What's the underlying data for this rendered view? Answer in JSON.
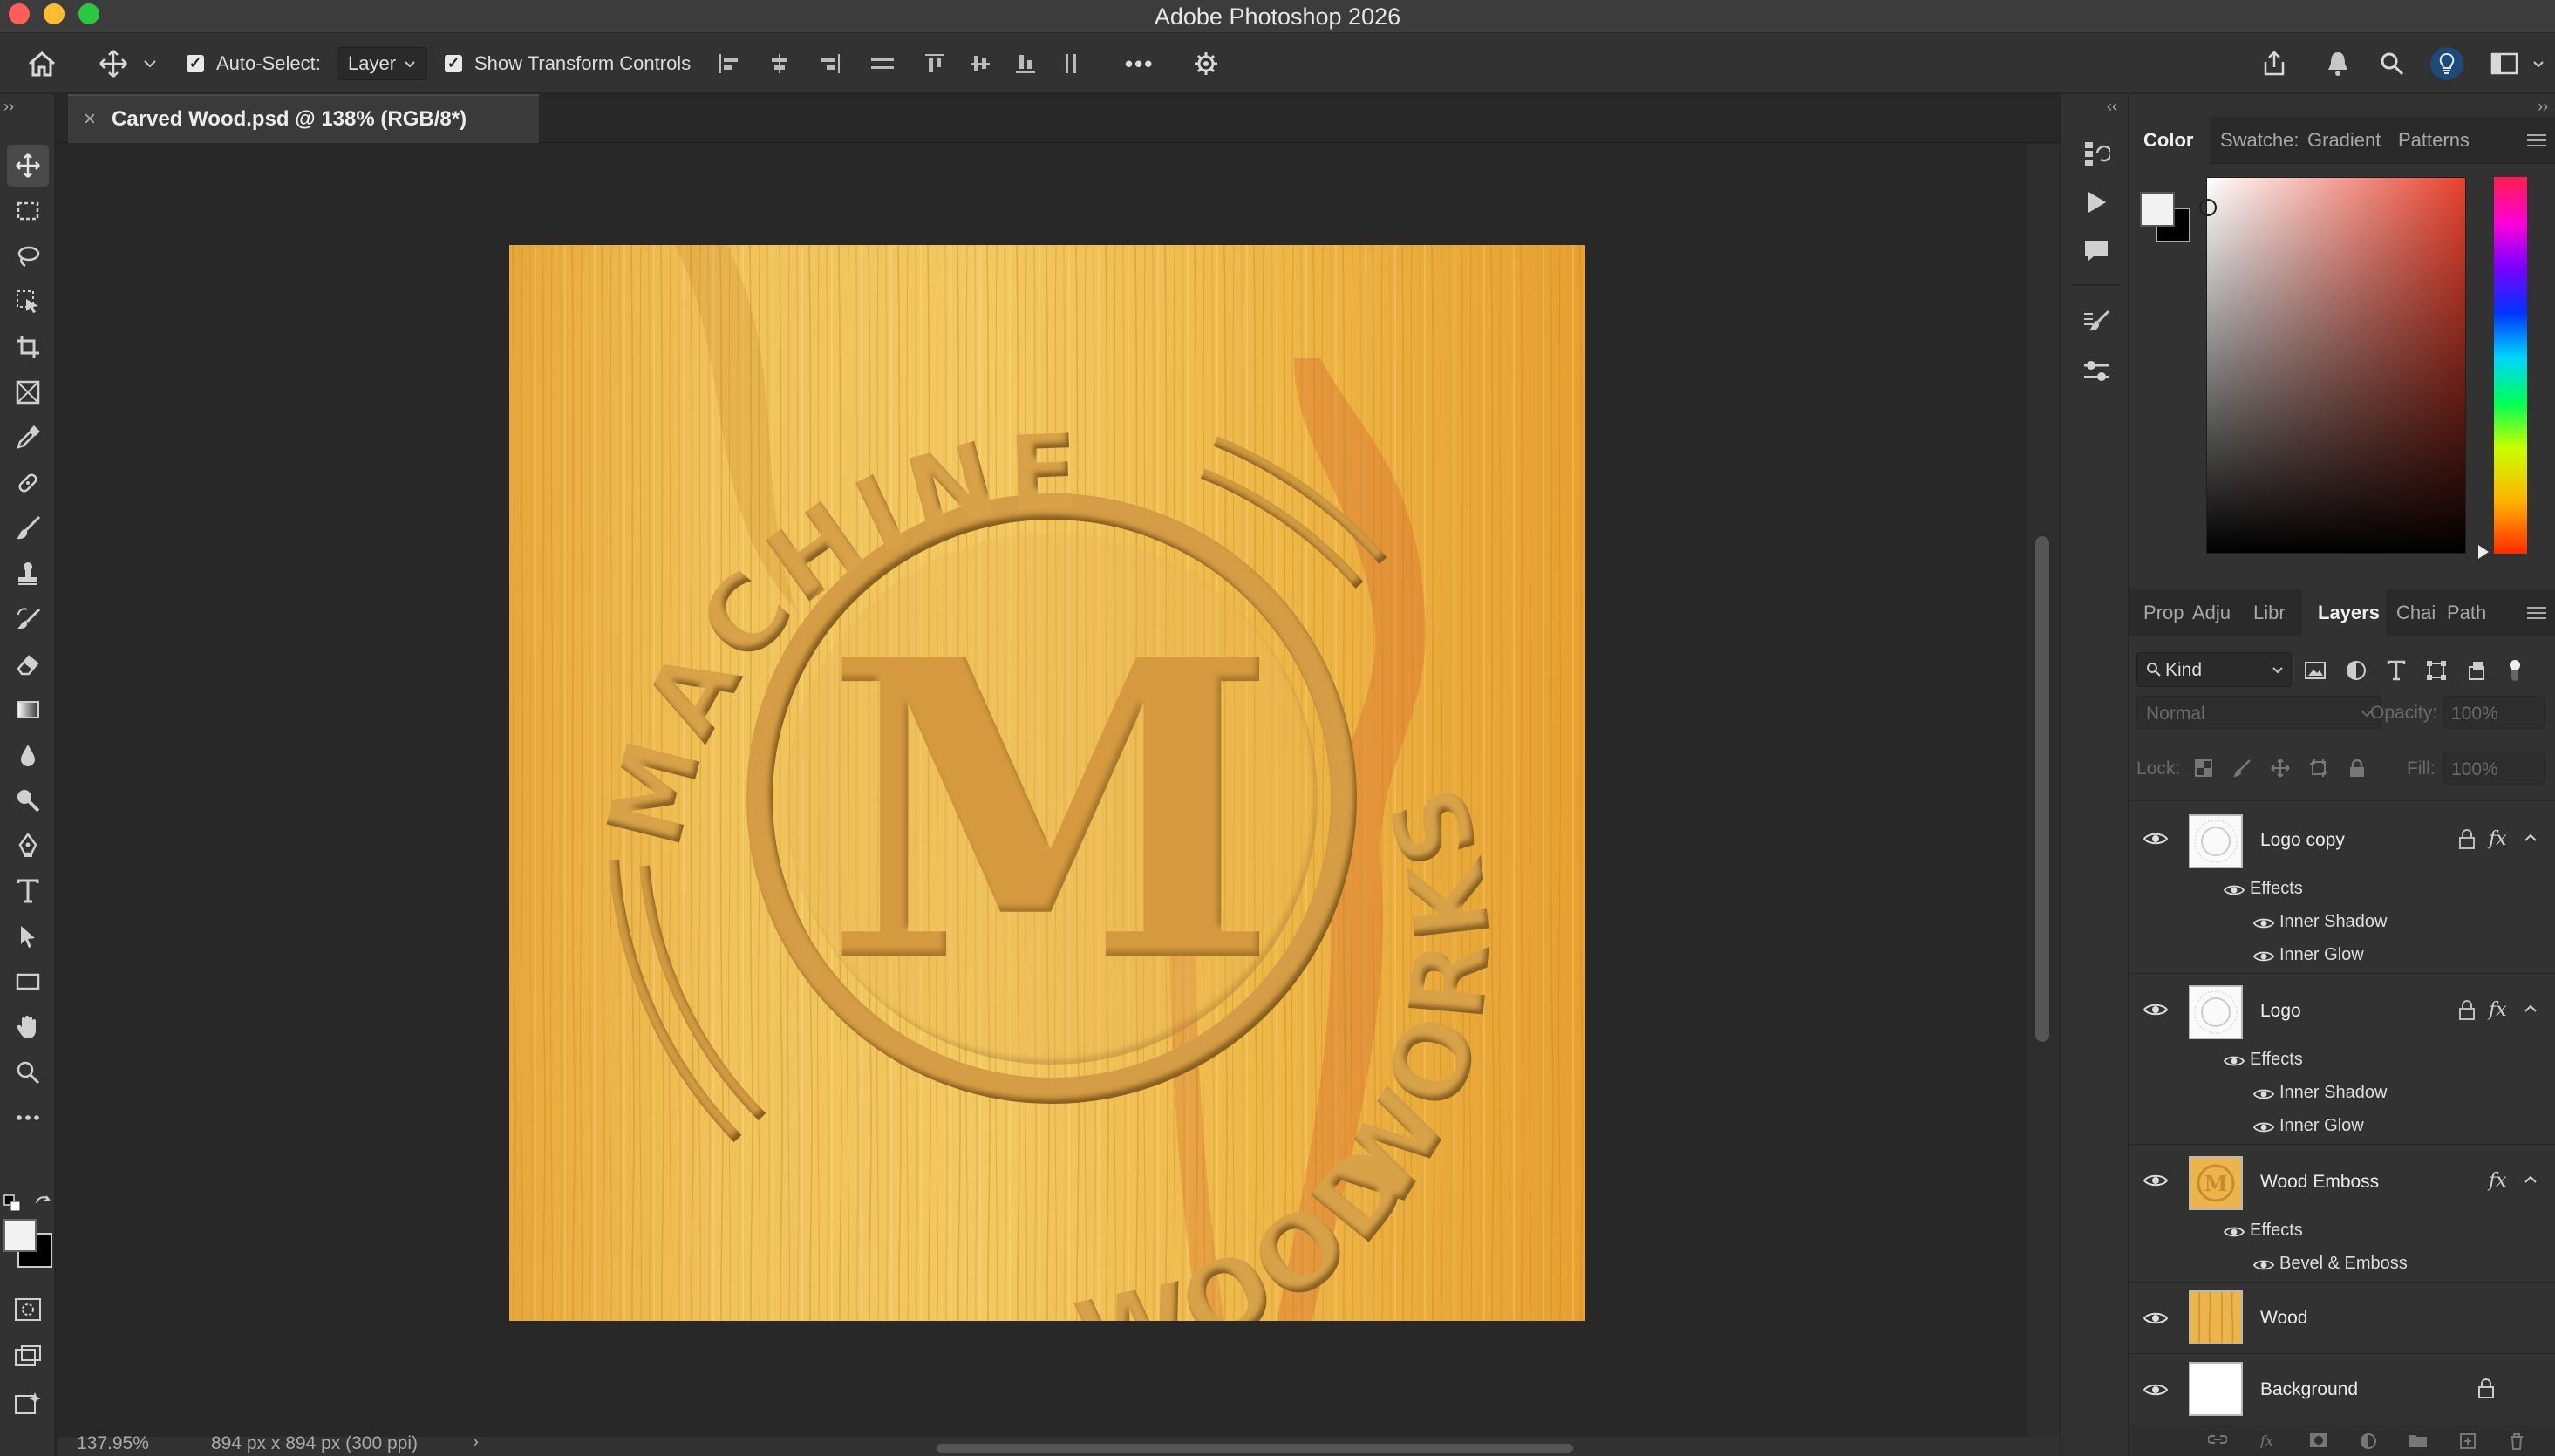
{
  "app": {
    "window_title": "Adobe Photoshop 2026"
  },
  "options_bar": {
    "auto_select_label": "Auto-Select:",
    "auto_select_checked": true,
    "auto_select_target": "Layer",
    "show_transform_label": "Show Transform Controls",
    "show_transform_checked": true,
    "more_label": "•••"
  },
  "document": {
    "tab_title": "Carved Wood.psd @ 138% (RGB/8*)",
    "close_glyph": "×",
    "artwork": {
      "top_text": "MACHINE",
      "right_text": "WORKS",
      "bottom_text": "WOOD",
      "center_letter": "M"
    }
  },
  "status_bar": {
    "zoom": "137.95%",
    "doc_info": "894 px x 894 px (300 ppi)",
    "arrow": "›"
  },
  "color_panel": {
    "tabs": [
      "Color",
      "Swatche:",
      "Gradient",
      "Patterns"
    ],
    "active_tab": "Color",
    "foreground": "#f2f2f2",
    "background": "#000000",
    "hue_color": "#e8412d"
  },
  "layers_panel": {
    "tabs": [
      "Prop",
      "Adju",
      "Libr",
      "Layers",
      "Chai",
      "Path"
    ],
    "active_tab": "Layers",
    "filter_kind": "Kind",
    "blend_mode": "Normal",
    "opacity_label": "Opacity:",
    "opacity_value": "100%",
    "lock_label": "Lock:",
    "fill_label": "Fill:",
    "fill_value": "100%",
    "layers": [
      {
        "name": "Logo copy",
        "effects_label": "Effects",
        "effects": [
          "Inner Shadow",
          "Inner Glow"
        ]
      },
      {
        "name": "Logo",
        "effects_label": "Effects",
        "effects": [
          "Inner Shadow",
          "Inner Glow"
        ]
      },
      {
        "name": "Wood Emboss",
        "effects_label": "Effects",
        "effects": [
          "Bevel & Emboss"
        ]
      },
      {
        "name": "Wood"
      },
      {
        "name": "Background"
      }
    ],
    "fx_glyph": "fx"
  }
}
